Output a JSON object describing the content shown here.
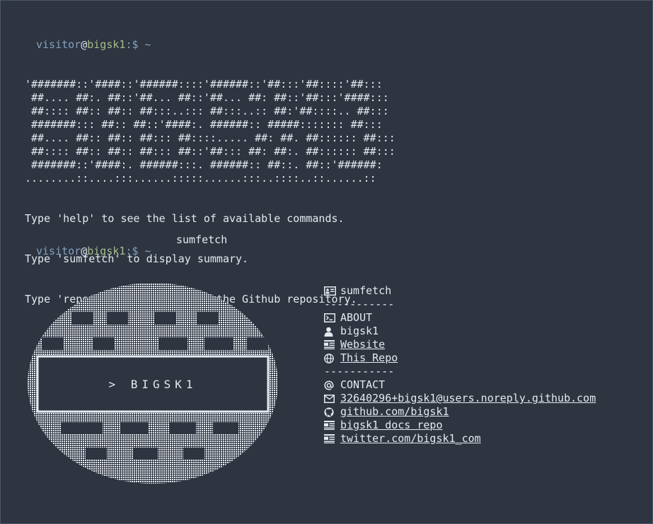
{
  "prompt": {
    "user": "visitor",
    "at": "@",
    "host": "bigsk1",
    "rest": ":$ ~"
  },
  "banner": "'#######::'####::'######::::'######::'##:::'##::::'##:::\n ##.... ##:. ##::'##... ##::'##... ##: ##::'##:::'####:::\n ##:::: ##:: ##:: ##:::..::: ##:::..:: ##:'##::::.. ##:::\n #######::: ##:: ##::'####:. ######:: #####::::::: ##:::\n ##.... ##:: ##:: ##::: ##::::..... ##: ##. ##:::::: ##:::\n ##:::: ##:: ##:: ##::: ##::'##::: ##: ##:. ##:::::: ##:::\n #######::'####:. ######:::. ######:: ##::. ##::'######:\n........::....:::......:::::......:::..::::..::......::",
  "help": {
    "line1": "Type 'help' to see the list of available commands.",
    "line2": "Type 'sumfetch' to display summary.",
    "line3_pre": "Type 'repo' or click ",
    "line3_link": "here",
    "line3_post": " for the Github repository."
  },
  "typed_command": "sumfetch",
  "logo": {
    "text": "> BIGSK1"
  },
  "summary": {
    "title": "sumfetch",
    "separator": "-----------",
    "about_heading": "ABOUT",
    "name": "bigsk1",
    "website": "Website",
    "this_repo": "This Repo",
    "separator2": "-----------",
    "contact_heading": "CONTACT",
    "email": "32640296+bigsk1@users.noreply.github.com",
    "github": "github.com/bigsk1",
    "docs": "bigsk1 docs repo",
    "twitter": "twitter.com/bigsk1_com"
  },
  "icons": {
    "title": "id-card-icon",
    "about": "terminal-icon",
    "name": "user-icon",
    "website": "newspaper-icon",
    "repo": "globe-icon",
    "contact": "at-icon",
    "email": "envelope-icon",
    "github": "github-icon",
    "docs": "newspaper-icon",
    "twitter": "newspaper-icon"
  },
  "colors": {
    "background": "#2e3440",
    "text": "#e5e9f0",
    "user": "#81a1c1",
    "host": "#a3be8c"
  }
}
